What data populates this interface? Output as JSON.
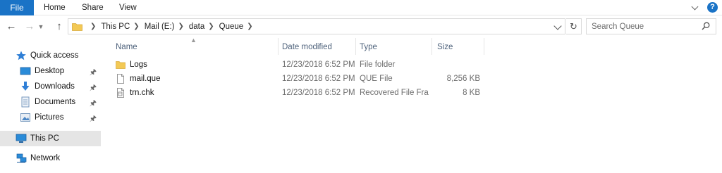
{
  "ribbon": {
    "tabs": [
      {
        "label": "File"
      },
      {
        "label": "Home"
      },
      {
        "label": "Share"
      },
      {
        "label": "View"
      }
    ],
    "help_label": "?"
  },
  "nav": {
    "breadcrumbs": [
      "This PC",
      "Mail (E:)",
      "data",
      "Queue"
    ],
    "search_placeholder": "Search Queue"
  },
  "sidebar": {
    "items": [
      {
        "label": "Quick access",
        "icon": "star-icon",
        "pinned": false
      },
      {
        "label": "Desktop",
        "icon": "desktop-icon",
        "pinned": true
      },
      {
        "label": "Downloads",
        "icon": "download-icon",
        "pinned": true
      },
      {
        "label": "Documents",
        "icon": "documents-icon",
        "pinned": true
      },
      {
        "label": "Pictures",
        "icon": "pictures-icon",
        "pinned": true
      },
      {
        "label": "This PC",
        "icon": "computer-icon",
        "pinned": false,
        "selected": true
      },
      {
        "label": "Network",
        "icon": "network-icon",
        "pinned": false
      }
    ]
  },
  "columns": {
    "name": "Name",
    "date": "Date modified",
    "type": "Type",
    "size": "Size"
  },
  "files": [
    {
      "name": "Logs",
      "date": "12/23/2018 6:52 PM",
      "type": "File folder",
      "size": "",
      "icon": "folder-icon"
    },
    {
      "name": "mail.que",
      "date": "12/23/2018 6:52 PM",
      "type": "QUE File",
      "size": "8,256 KB",
      "icon": "file-icon"
    },
    {
      "name": "trn.chk",
      "date": "12/23/2018 6:52 PM",
      "type": "Recovered File Fra...",
      "size": "8 KB",
      "icon": "chk-file-icon"
    }
  ],
  "colors": {
    "accent": "#1a73c6",
    "folder": "#f3c955",
    "selected_bg": "#e5e5e5"
  }
}
